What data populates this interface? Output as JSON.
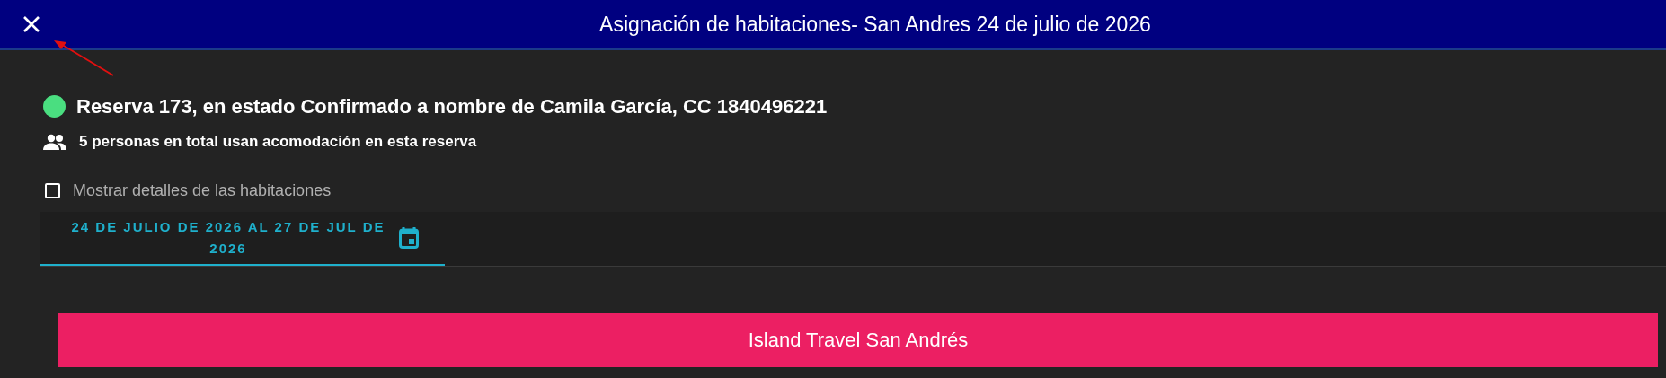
{
  "window": {
    "title": "Asignación de habitaciones- San Andres 24 de julio de 2026"
  },
  "reservation": {
    "color": "#4ade80",
    "summary": "Reserva 173, en estado Confirmado a nombre de Camila García, CC 1840496221",
    "people": "5 personas en total usan acomodación en esta reserva"
  },
  "show_details": {
    "label": "Mostrar detalles de las habitaciones",
    "checked": false
  },
  "tabs": [
    {
      "label": "24 DE JULIO DE 2026 AL 27 DE JUL DE 2026",
      "selected": true
    }
  ],
  "hotels": [
    {
      "name": "Island Travel San Andrés"
    }
  ]
}
